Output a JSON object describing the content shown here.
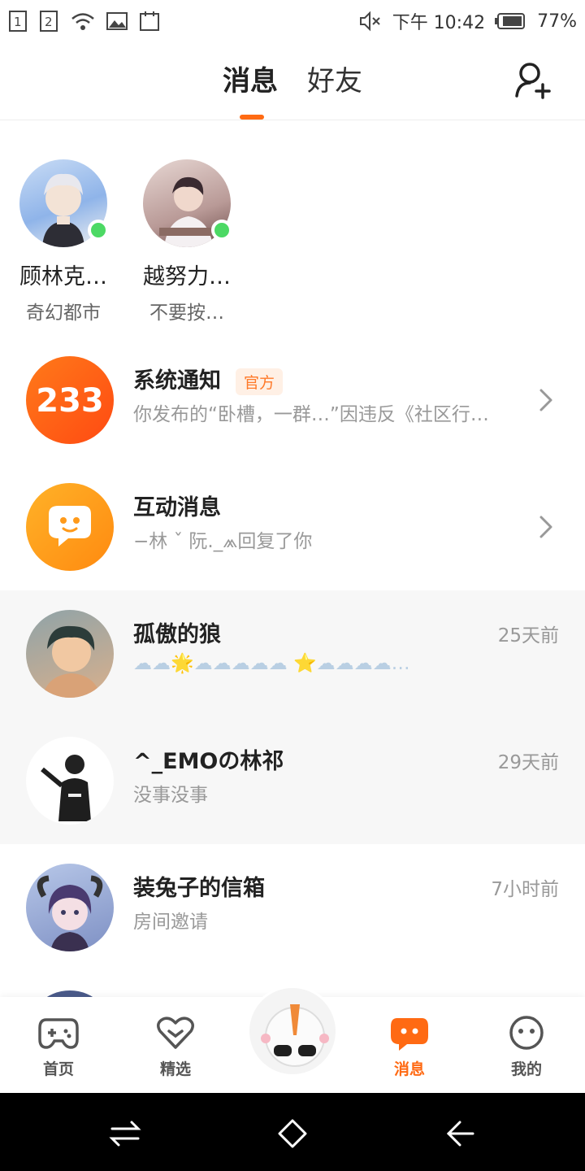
{
  "status_bar": {
    "sim1": "1",
    "sim2": "2",
    "time": "下午 10:42",
    "battery": "77%"
  },
  "header": {
    "tabs": [
      {
        "label": "消息",
        "active": true
      },
      {
        "label": "好友",
        "active": false
      }
    ],
    "add_friend_icon": "add-user-icon",
    "accent_color": "#ff6a13"
  },
  "online_friends": [
    {
      "name": "顾林克…",
      "game": "奇幻都市",
      "online": true
    },
    {
      "name": "越努力…",
      "game": "不要按…",
      "online": true
    }
  ],
  "system_rows": [
    {
      "title": "系统通知",
      "badge": "官方",
      "preview": "你发布的“卧槽，一群…”因违反《社区行…",
      "icon_text": "233"
    },
    {
      "title": "互动消息",
      "preview": "−林 ˇ 阮._⩕回复了你"
    }
  ],
  "conversations": [
    {
      "name": "孤傲的狼",
      "preview": "☁☁🌟☁☁☁☁☁ ⭐☁☁☁☁…",
      "time": "25天前",
      "highlight": true
    },
    {
      "name": "^_EMOの林祁",
      "preview": "没事没事",
      "time": "29天前",
      "highlight": true
    },
    {
      "name": "装兔子的信箱",
      "preview": "房间邀请",
      "time": "7小时前",
      "highlight": false
    }
  ],
  "bottom_nav": [
    {
      "label": "首页",
      "icon": "gamepad-icon",
      "active": false
    },
    {
      "label": "精选",
      "icon": "heart-icon",
      "active": false
    },
    {
      "label": "消息",
      "icon": "message-icon",
      "active": true
    },
    {
      "label": "我的",
      "icon": "face-icon",
      "active": false
    }
  ]
}
